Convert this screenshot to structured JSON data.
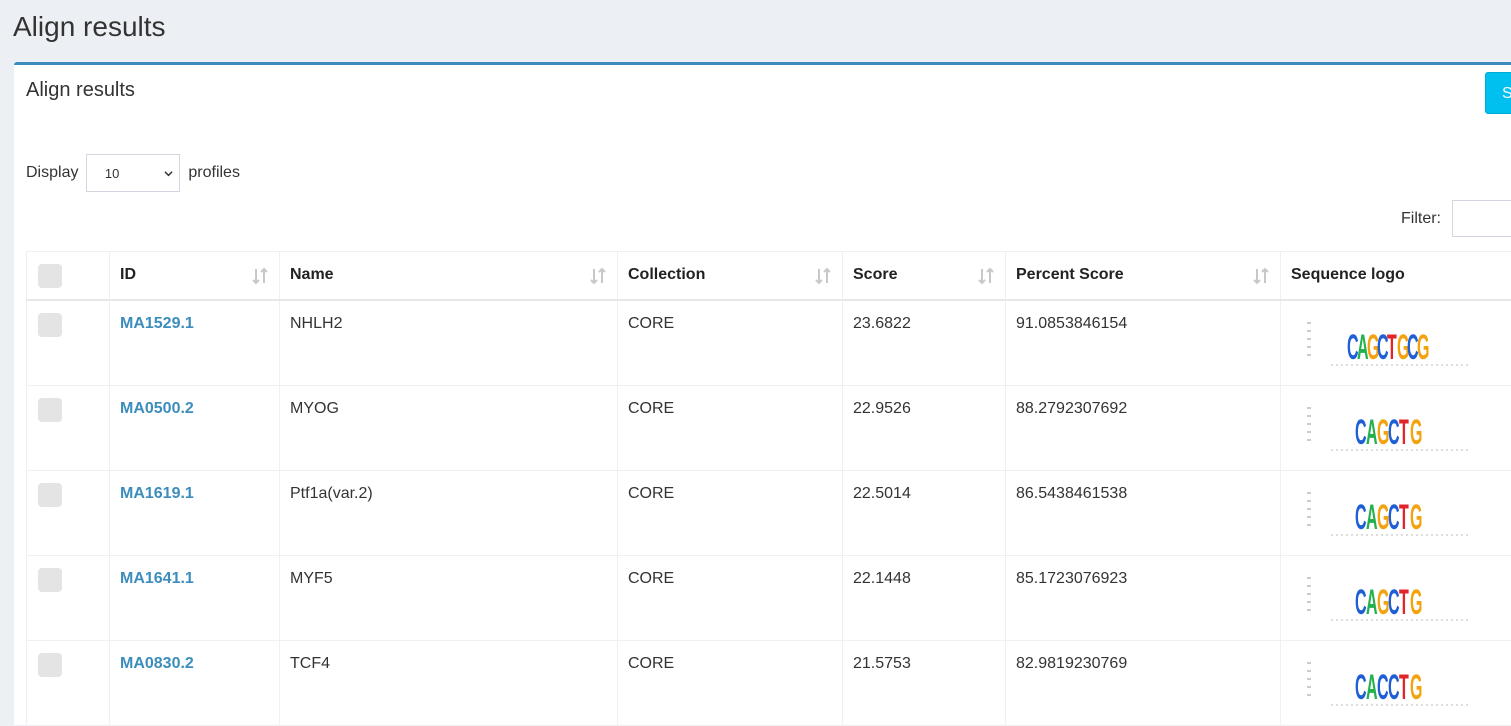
{
  "page": {
    "title": "Align results"
  },
  "box": {
    "title": "Align results",
    "top_button_label": "S"
  },
  "length_menu": {
    "prefix": "Display",
    "selected": "10",
    "suffix": "profiles"
  },
  "filter": {
    "label": "Filter:",
    "value": ""
  },
  "table": {
    "headers": {
      "id": "ID",
      "name": "Name",
      "collection": "Collection",
      "score": "Score",
      "percent_score": "Percent Score",
      "sequence_logo": "Sequence logo"
    },
    "rows": [
      {
        "id": "MA1529.1",
        "name": "NHLH2",
        "collection": "CORE",
        "score": "23.6822",
        "percent_score": "91.0853846154",
        "logo": "CAGCTGCG"
      },
      {
        "id": "MA0500.2",
        "name": "MYOG",
        "collection": "CORE",
        "score": "22.9526",
        "percent_score": "88.2792307692",
        "logo": "CAGCTG"
      },
      {
        "id": "MA1619.1",
        "name": "Ptf1a(var.2)",
        "collection": "CORE",
        "score": "22.5014",
        "percent_score": "86.5438461538",
        "logo": "CAGCTG"
      },
      {
        "id": "MA1641.1",
        "name": "MYF5",
        "collection": "CORE",
        "score": "22.1448",
        "percent_score": "85.1723076923",
        "logo": "CAGCTG"
      },
      {
        "id": "MA0830.2",
        "name": "TCF4",
        "collection": "CORE",
        "score": "21.5753",
        "percent_score": "82.9819230769",
        "logo": "CACCTG"
      }
    ]
  },
  "colors": {
    "accent": "#3c8dbc",
    "button": "#00c0ef",
    "background": "#ecf0f5"
  }
}
